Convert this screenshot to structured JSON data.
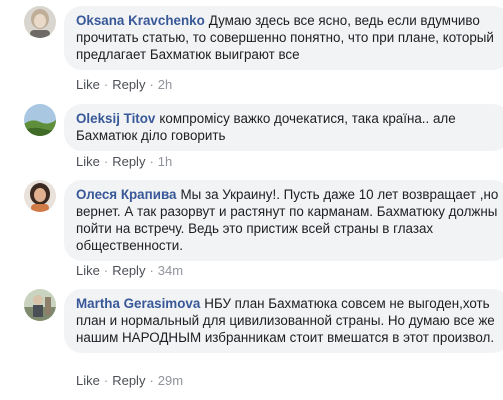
{
  "comments": [
    {
      "author": "Oksana Kravchenko",
      "text": "Думаю здесь все ясно, ведь если вдумчиво прочитать статью, то совершенно понятно, что при плане, который предлагает Бахматюк выиграют все",
      "like_label": "Like",
      "reply_label": "Reply",
      "time": "2h",
      "avatar_icon": "user-avatar-woman-light-hair"
    },
    {
      "author": "Oleksij Titov",
      "text": "компромісу важко дочекатися, така країна.. але Бахматюк діло говорить",
      "like_label": "Like",
      "reply_label": "Reply",
      "time": "1h",
      "avatar_icon": "user-avatar-landscape"
    },
    {
      "author": "Олеся Крапива",
      "text": "Мы за Украину!. Пусть даже 10 лет возвращает ,но вернет. А так разорвут и растянут по карманам. Бахматюку должны пойти на встречу. Ведь это пристиж всей страны в глазах общественности.",
      "like_label": "Like",
      "reply_label": "Reply",
      "time": "34m",
      "avatar_icon": "user-avatar-woman-dark-hair"
    },
    {
      "author": "Martha Gerasimova",
      "text": "НБУ план Бахматюка совсем не выгоден,хоть план и нормальный для цивилизованной страны. Но думаю все же нашим НАРОДНЫМ избранникам стоит вмешатся в этот произвол.",
      "like_label": "Like",
      "reply_label": "Reply",
      "time": "29m",
      "avatar_icon": "user-avatar-outdoor"
    }
  ],
  "colors": {
    "author_link": "#385898",
    "bubble_bg": "#f2f3f5",
    "meta_text": "#90949c"
  }
}
